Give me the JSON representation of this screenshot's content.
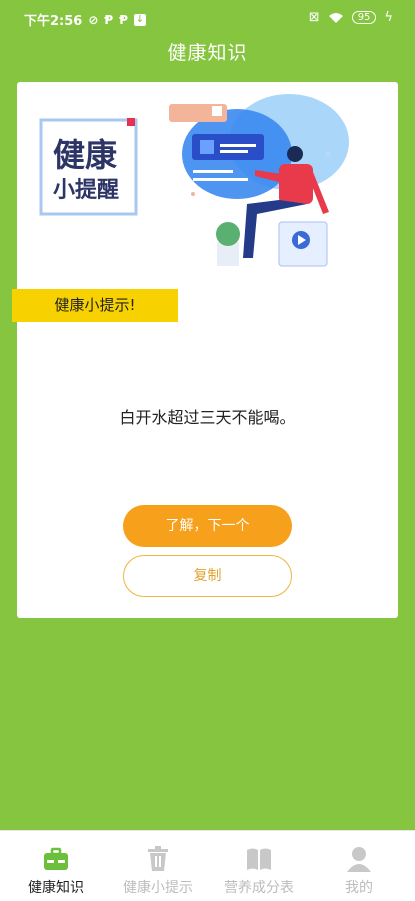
{
  "status_bar": {
    "time": "下午2:56",
    "battery": "95"
  },
  "header": {
    "title": "健康知识"
  },
  "illustration": {
    "sign_line1": "健康",
    "sign_line2": "小提醒"
  },
  "card": {
    "tip_banner": "健康小提示!",
    "tip_text": "白开水超过三天不能喝。",
    "next_button": "了解，下一个",
    "copy_button": "复制"
  },
  "tabs": [
    {
      "label": "健康知识",
      "icon": "medkit-icon",
      "active": true
    },
    {
      "label": "健康小提示",
      "icon": "trash-icon",
      "active": false
    },
    {
      "label": "营养成分表",
      "icon": "book-icon",
      "active": false
    },
    {
      "label": "我的",
      "icon": "user-icon",
      "active": false
    }
  ],
  "colors": {
    "background": "#85c540",
    "accent_orange": "#f7a01c",
    "banner_yellow": "#f8d200"
  }
}
